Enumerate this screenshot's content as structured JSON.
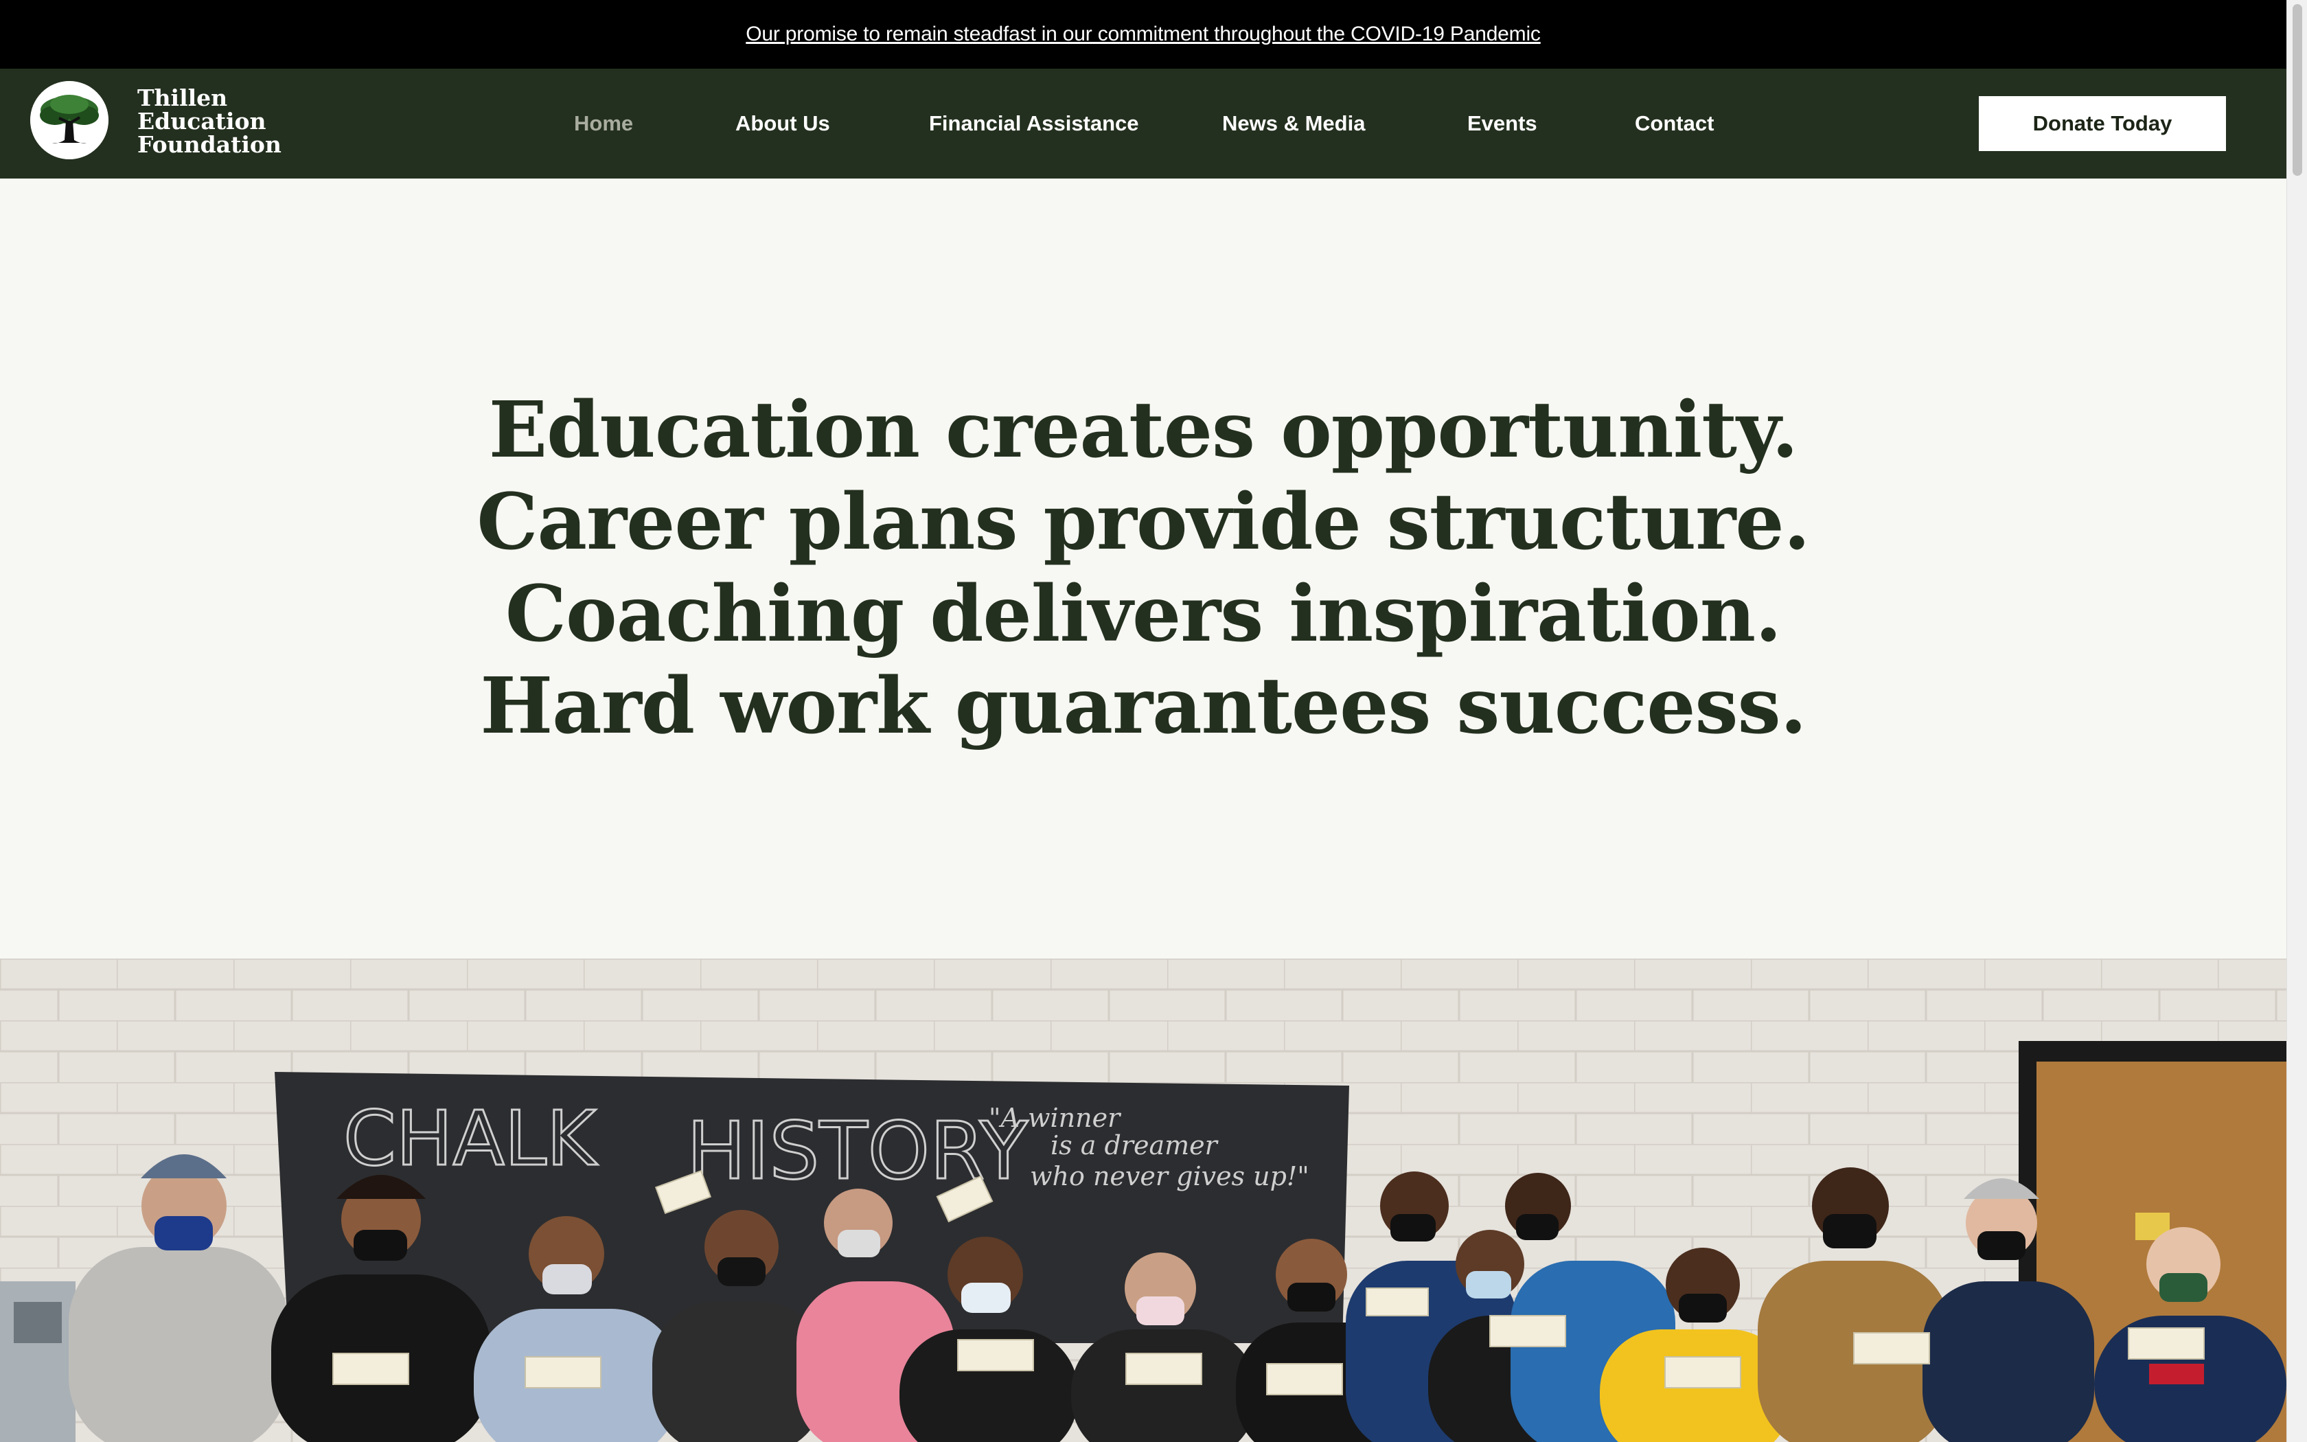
{
  "announcement": {
    "text": "Our promise to remain steadfast in our commitment throughout the COVID-19 Pandemic"
  },
  "brand": {
    "line1": "Thillen",
    "line2": "Education",
    "line3": "Foundation"
  },
  "nav": {
    "items": [
      {
        "label": "Home",
        "active": true
      },
      {
        "label": "About Us"
      },
      {
        "label": "Financial Assistance"
      },
      {
        "label": "News & Media"
      },
      {
        "label": "Events"
      },
      {
        "label": "Contact"
      }
    ],
    "donate_label": "Donate Today"
  },
  "hero": {
    "lines": [
      "Education creates opportunity.",
      "Career plans provide structure.",
      "Coaching delivers inspiration.",
      "Hard work guarantees success."
    ]
  },
  "photo": {
    "chalkboard_text": [
      "CHALK",
      "HISTORY",
      "\"A winner",
      "is a dreamer",
      "who never gives up!\""
    ]
  },
  "colors": {
    "header_bg": "#24301f",
    "announcement_bg": "#000000",
    "page_bg": "#f7f7f3",
    "heading": "#24301f",
    "nav_active": "#a9ad9f"
  }
}
